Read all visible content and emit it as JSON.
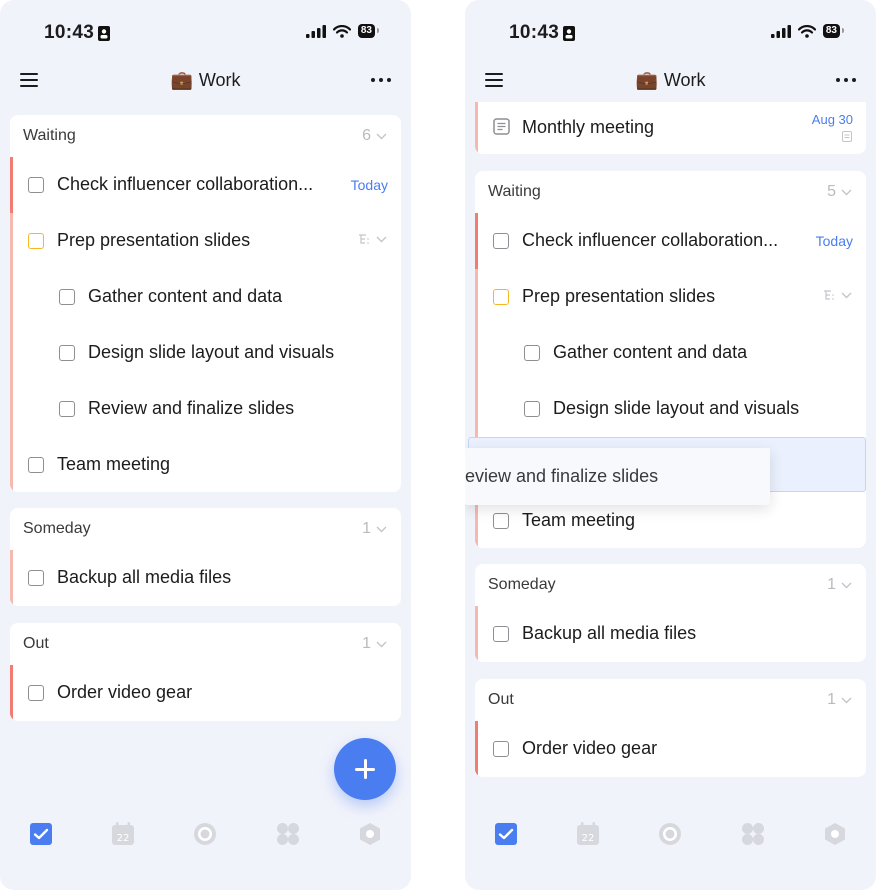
{
  "status": {
    "time": "10:43",
    "battery": "83"
  },
  "header": {
    "project_emoji": "💼",
    "title": "Work"
  },
  "colors": {
    "accent": "#4a7ef0",
    "stripe_red": "#f07c72",
    "stripe_pink": "#f5b9b0",
    "priority_yellow": "#f5b824"
  },
  "left": {
    "sections": [
      {
        "title": "Waiting",
        "count": "6",
        "tasks": [
          {
            "text": "Check influencer collaboration...",
            "date": "Today"
          },
          {
            "text": "Prep presentation slides"
          },
          {
            "text": "Gather content and data"
          },
          {
            "text": "Design slide layout and visuals"
          },
          {
            "text": "Review and finalize slides"
          },
          {
            "text": "Team meeting"
          }
        ]
      },
      {
        "title": "Someday",
        "count": "1",
        "tasks": [
          {
            "text": "Backup all media files"
          }
        ]
      },
      {
        "title": "Out",
        "count": "1",
        "tasks": [
          {
            "text": "Order video gear"
          }
        ]
      }
    ]
  },
  "right": {
    "top_task": {
      "text": "Monthly meeting",
      "date": "Aug 30"
    },
    "sections": [
      {
        "title": "Waiting",
        "count": "5",
        "tasks": [
          {
            "text": "Check influencer collaboration...",
            "date": "Today"
          },
          {
            "text": "Prep presentation slides"
          },
          {
            "text": "Gather content and data"
          },
          {
            "text": "Design slide layout and visuals"
          },
          {
            "text": "Team meeting"
          }
        ]
      },
      {
        "title": "Someday",
        "count": "1",
        "tasks": [
          {
            "text": "Backup all media files"
          }
        ]
      },
      {
        "title": "Out",
        "count": "1",
        "tasks": [
          {
            "text": "Order video gear"
          }
        ]
      }
    ],
    "drag_ghost_text": "eview and finalize slides"
  },
  "tabs": [
    {
      "name": "tasks-tab",
      "icon": "checkbox-icon",
      "active": true
    },
    {
      "name": "calendar-tab",
      "icon": "calendar-icon",
      "label": "22"
    },
    {
      "name": "focus-tab",
      "icon": "focus-icon"
    },
    {
      "name": "apps-tab",
      "icon": "grid-icon"
    },
    {
      "name": "settings-tab",
      "icon": "hexagon-icon"
    }
  ]
}
